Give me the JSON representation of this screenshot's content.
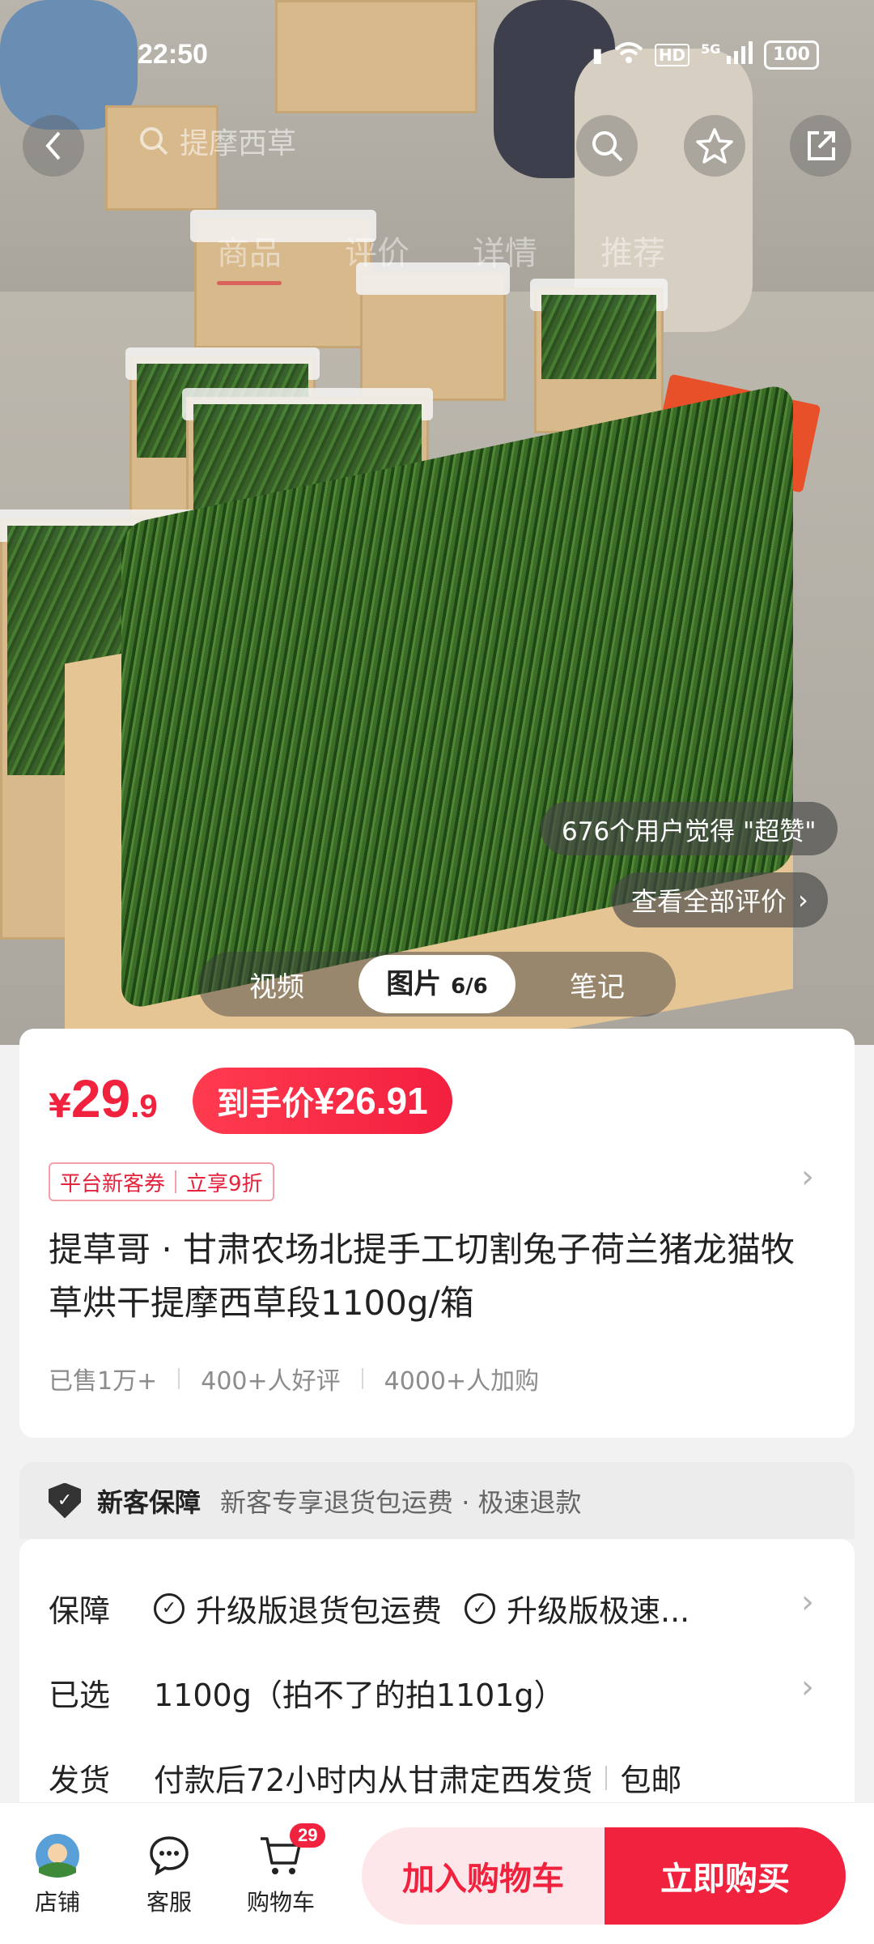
{
  "status_bar": {
    "time": "22:50",
    "battery": "100",
    "network": "5G",
    "hd": "HD"
  },
  "nav": {
    "search_text": "提摩西草",
    "tabs": [
      {
        "label": "商品"
      },
      {
        "label": "评价"
      },
      {
        "label": "详情"
      },
      {
        "label": "推荐"
      }
    ]
  },
  "media": {
    "praise_tag": "676个用户觉得 \"超赞\"",
    "see_all_reviews": "查看全部评价",
    "segments": {
      "video": "视频",
      "image": "图片",
      "image_counter": "6/6",
      "notes": "笔记"
    }
  },
  "product": {
    "currency": "¥",
    "price_int": "29",
    "price_dec": ".9",
    "final_price_label": "到手价",
    "final_price": "¥26.91",
    "coupon_left": "平台新客券",
    "coupon_right": "立享9折",
    "title": "提草哥 · 甘肃农场北提手工切割兔子荷兰猪龙猫牧草烘干提摩西草段1100g/箱",
    "stats": [
      "已售1万+",
      "400+人好评",
      "4000+人加购"
    ]
  },
  "guarantee": {
    "title": "新客保障",
    "desc": "新客专享退货包运费 · 极速退款"
  },
  "details": {
    "protection_label": "保障",
    "protection_items": [
      "升级版退货包运费",
      "升级版极速..."
    ],
    "selected_label": "已选",
    "selected_value": "1100g（拍不了的拍1101g）",
    "shipping_label": "发货",
    "shipping_value": "付款后72小时内从甘肃定西发货",
    "shipping_extra": "包邮"
  },
  "bottom_bar": {
    "shop": "店铺",
    "service": "客服",
    "cart": "购物车",
    "cart_count": "29",
    "add_to_cart": "加入购物车",
    "buy_now": "立即购买"
  },
  "colors": {
    "accent": "#f0223d",
    "accent_light": "#fde7ea"
  }
}
